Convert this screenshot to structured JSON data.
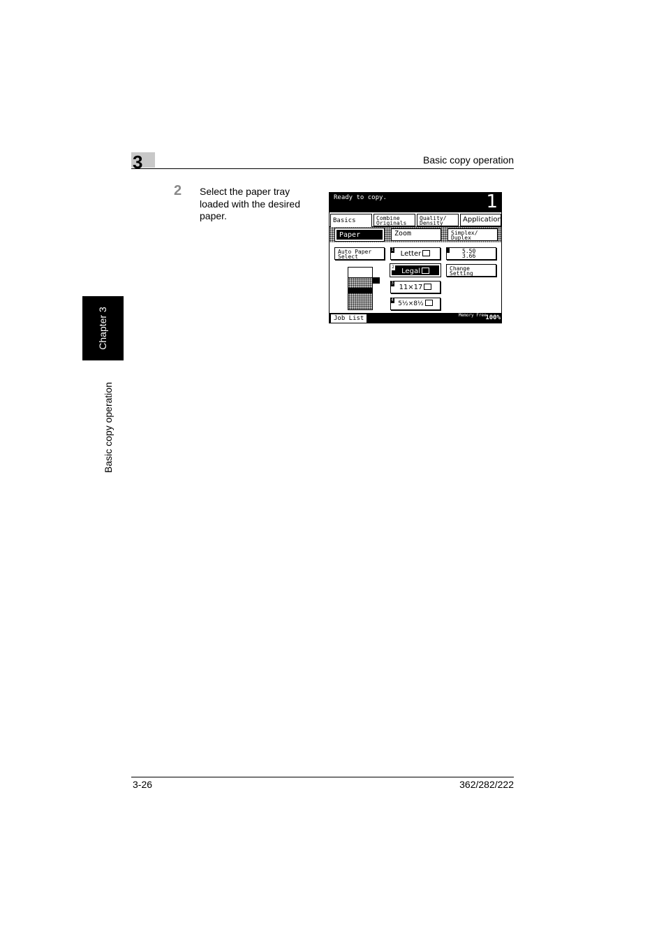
{
  "header": {
    "chapter_number": "3",
    "title": "Basic copy operation"
  },
  "side": {
    "chapter_label": "Chapter 3",
    "section_label": "Basic copy operation"
  },
  "step": {
    "number": "2",
    "text": "Select the paper tray loaded with the desired paper."
  },
  "screen": {
    "status": "Ready to copy.",
    "copy_count": "1",
    "tabs": [
      "Basics",
      "Combine Originals",
      "Quality/ Density",
      "Application"
    ],
    "subtabs": [
      "Paper",
      "Zoom",
      "Simplex/ Duplex"
    ],
    "auto_paper": "Auto Paper Select",
    "trays": [
      {
        "badge": "1",
        "label": "Letter"
      },
      {
        "badge": "2",
        "label": "Legal"
      },
      {
        "badge": "3",
        "label": "11×17"
      },
      {
        "badge": "4",
        "label": "5½×8½"
      }
    ],
    "zoom_values": [
      "5.50",
      "3.66"
    ],
    "change_setting": "Change Setting",
    "job_list": "Job List",
    "memory_label": "Memory Free",
    "memory_value": "100%"
  },
  "footer": {
    "page": "3-26",
    "model": "362/282/222"
  }
}
